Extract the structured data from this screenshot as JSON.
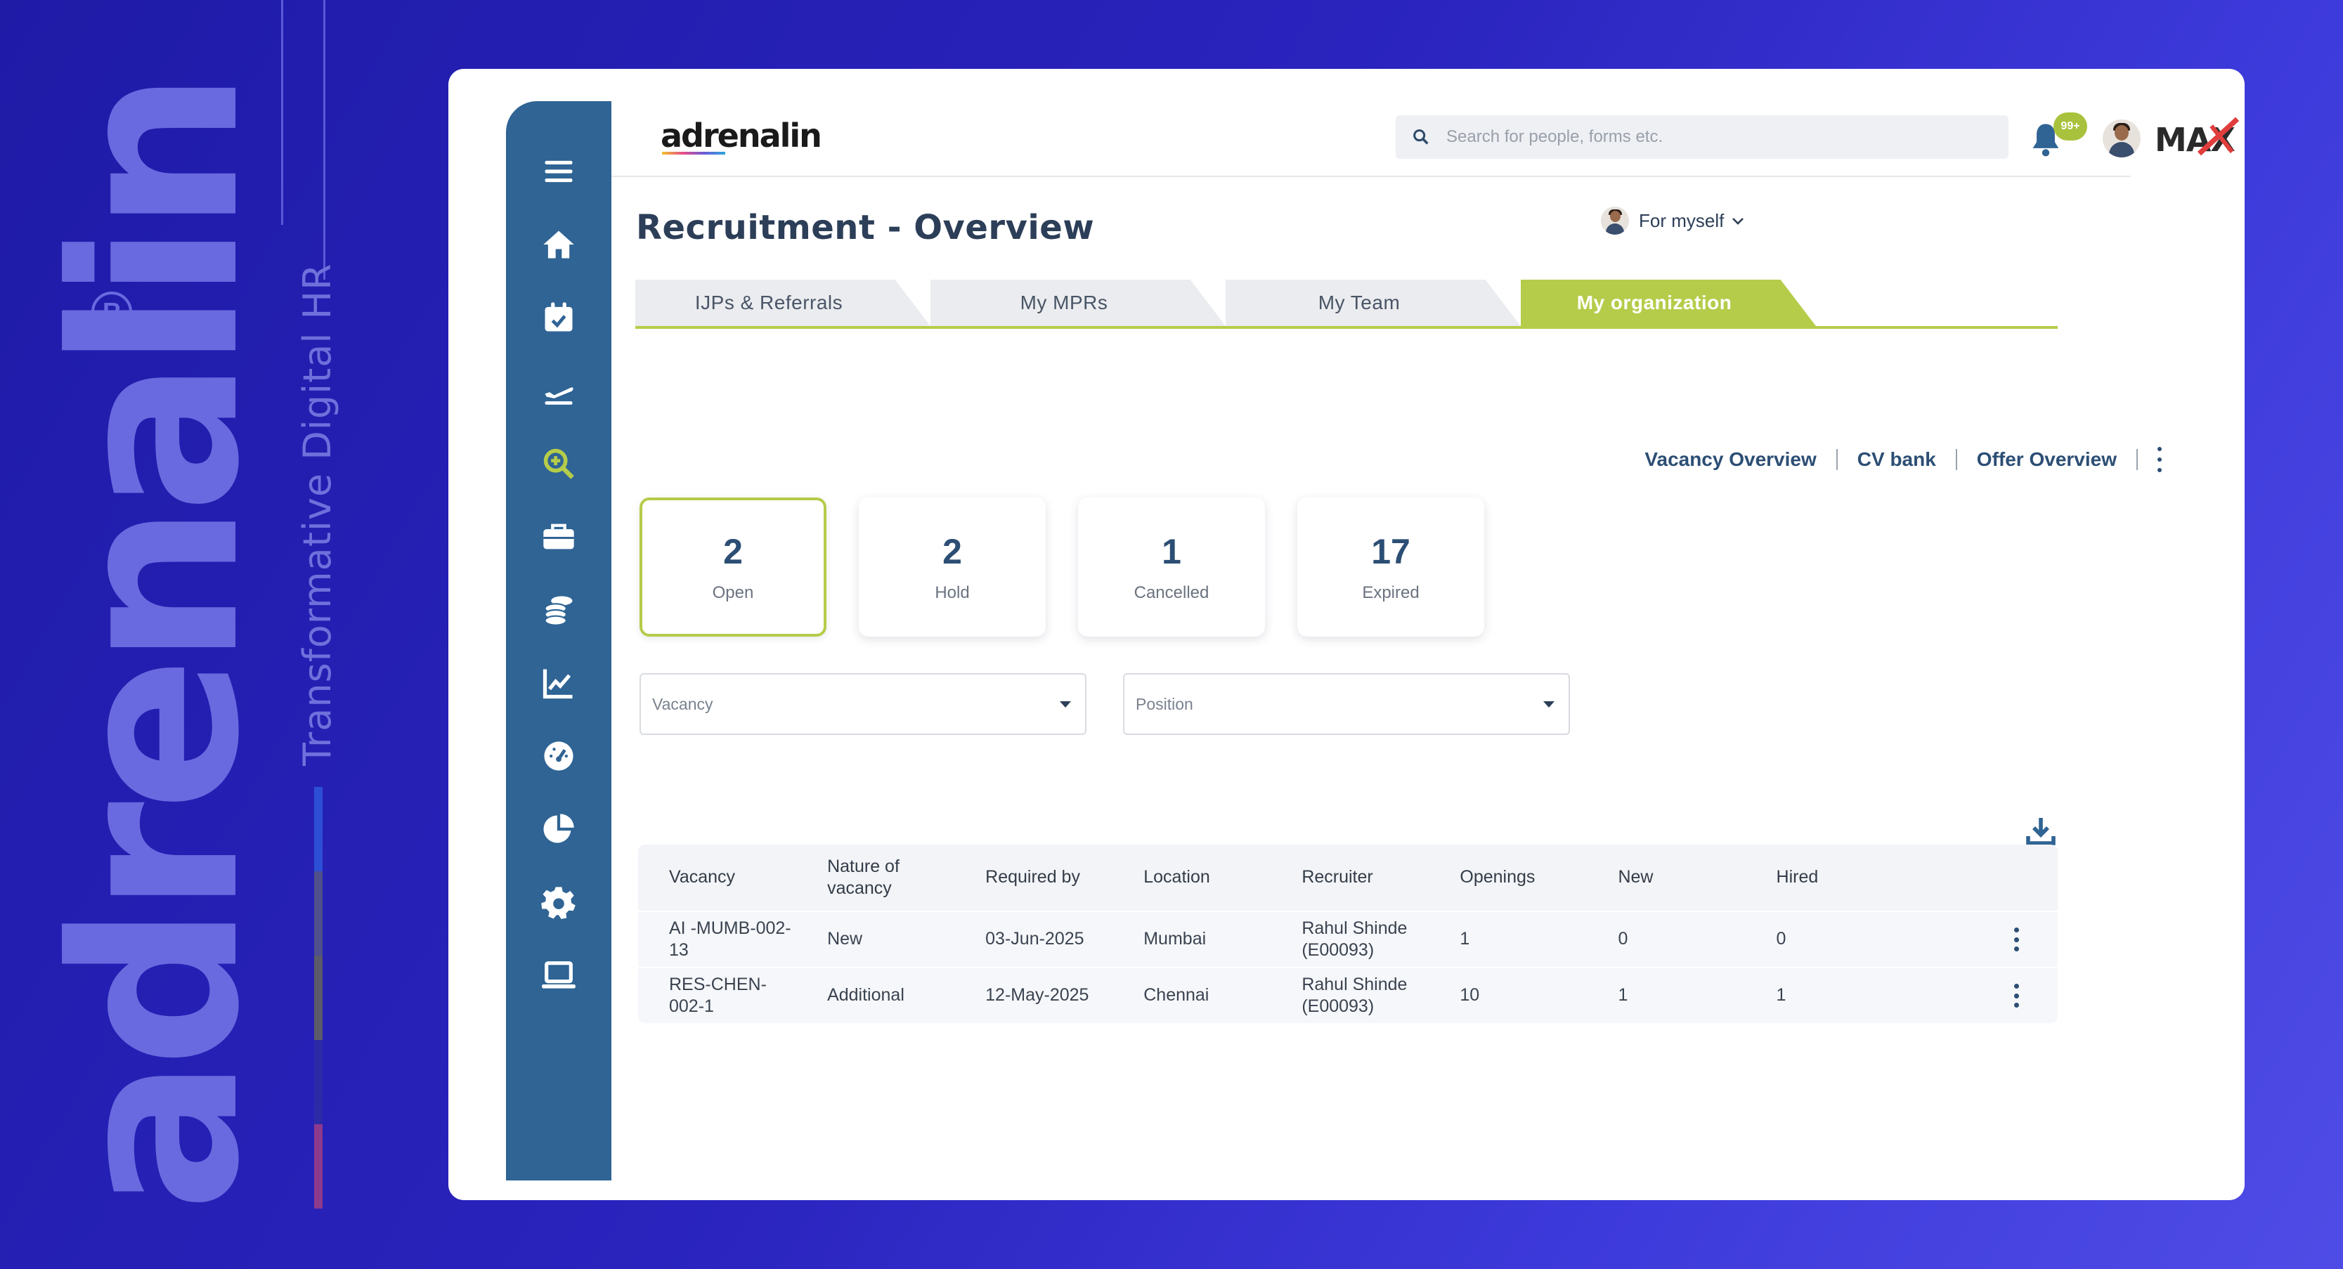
{
  "brand": {
    "wordmark": "adrenalin",
    "registered": "R",
    "tagline": "Transformative Digital HR",
    "bar_colors": [
      "#2d4fd6",
      "#4f4f8c",
      "#5a5a6a",
      "#2d2aa8",
      "#8c3a8c"
    ]
  },
  "sidebar": {
    "icons": [
      "menu-icon",
      "home-icon",
      "calendar-check-icon",
      "flight-icon",
      "search-plus-icon",
      "briefcase-icon",
      "coins-icon",
      "chart-line-icon",
      "gauge-icon",
      "pie-chart-icon",
      "gear-icon",
      "laptop-icon"
    ],
    "active": "search-plus-icon",
    "active_color": "#b5cc4a"
  },
  "header": {
    "logo": "adrenalin",
    "search_placeholder": "Search for people, forms etc.",
    "notification_badge": "99+",
    "company_logo": "MAX"
  },
  "page": {
    "title": "Recruitment - Overview",
    "scope_selector": "For myself"
  },
  "tabs": [
    {
      "label": "IJPs & Referrals",
      "active": false
    },
    {
      "label": "My MPRs",
      "active": false
    },
    {
      "label": "My Team",
      "active": false
    },
    {
      "label": "My organization",
      "active": true
    }
  ],
  "sublinks": [
    "Vacancy Overview",
    "CV bank",
    "Offer Overview"
  ],
  "stats": [
    {
      "value": "2",
      "label": "Open",
      "active": true
    },
    {
      "value": "2",
      "label": "Hold",
      "active": false
    },
    {
      "value": "1",
      "label": "Cancelled",
      "active": false
    },
    {
      "value": "17",
      "label": "Expired",
      "active": false
    }
  ],
  "filters": {
    "vacancy_placeholder": "Vacancy",
    "position_placeholder": "Position"
  },
  "table": {
    "columns": [
      "Vacancy",
      "Nature of vacancy",
      "Required by",
      "Location",
      "Recruiter",
      "Openings",
      "New",
      "Hired"
    ],
    "rows": [
      [
        "AI -MUMB-002-13",
        "New",
        "03-Jun-2025",
        "Mumbai",
        "Rahul Shinde (E00093)",
        "1",
        "0",
        "0"
      ],
      [
        "RES-CHEN-002-1",
        "Additional",
        "12-May-2025",
        "Chennai",
        "Rahul Shinde (E00093)",
        "10",
        "1",
        "1"
      ]
    ]
  },
  "colors": {
    "accent": "#b5cc4a",
    "primary": "#2f6494",
    "title": "#2c3e58",
    "link": "#2c4e74",
    "background": "#2a23bd"
  }
}
